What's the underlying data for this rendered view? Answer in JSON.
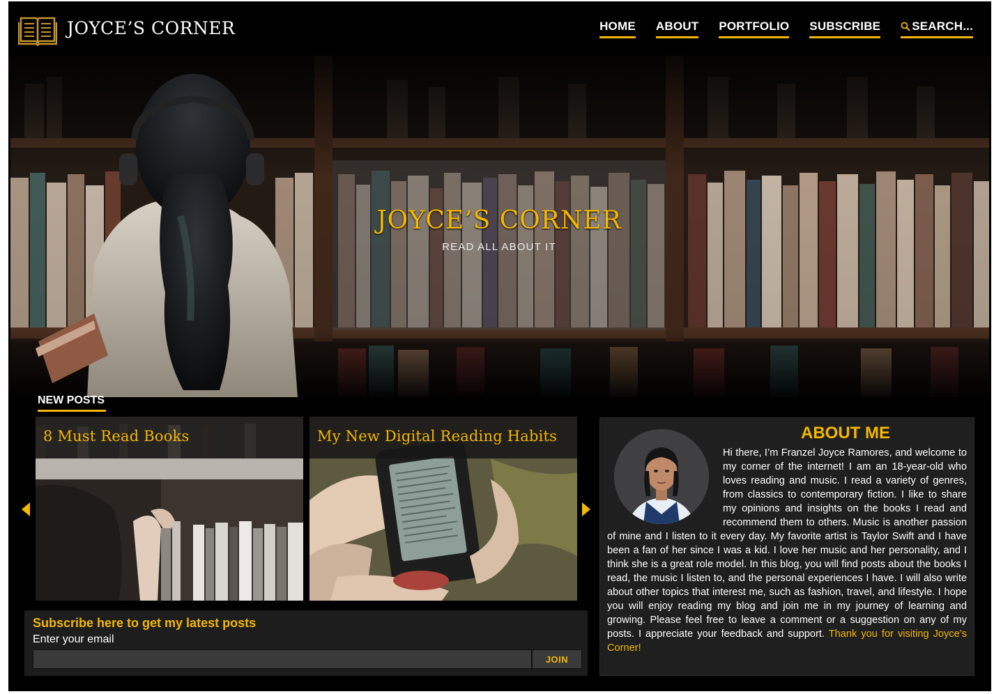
{
  "header": {
    "brand": "JOYCE’S CORNER",
    "logo_icon": "open-book-icon",
    "nav": [
      {
        "label": "HOME"
      },
      {
        "label": "ABOUT"
      },
      {
        "label": "PORTFOLIO"
      },
      {
        "label": "SUBSCRIBE"
      }
    ],
    "search_label": "SEARCH...",
    "search_icon": "search-icon"
  },
  "hero": {
    "title": "JOYCE’S CORNER",
    "tagline": "READ ALL ABOUT IT"
  },
  "new_posts": {
    "label": "NEW POSTS",
    "posts": [
      {
        "title": "8 Must Read Books"
      },
      {
        "title": "My New Digital Reading Habits"
      }
    ],
    "prev_icon": "caret-left-icon",
    "next_icon": "caret-right-icon"
  },
  "subscribe": {
    "heading": "Subscribe here to get my latest posts",
    "label": "Enter your email",
    "input_value": "",
    "button": "JOIN"
  },
  "about": {
    "title": "ABOUT ME",
    "body": "Hi there, I’m Franzel Joyce Ramores, and welcome to my corner of the internet! I am an 18-year-old who loves reading and music. I read a variety of genres, from classics to contemporary fiction. I like to share my opinions and insights on the books I read and recommend them to others. Music is another passion of mine and I listen to it every day. My favorite artist is Taylor Swift and I have been a fan of her since I was a kid. I love her music and her personality, and I think she is a great role model. In this blog, you will find posts about the books I read, the music I listen to, and the personal experiences I have. I will also write about other topics that interest me, such as fashion, travel, and lifestyle. I hope you will enjoy reading my blog and join me in my journey of learning and growing. Please feel free to leave a comment or a suggestion on any of my posts. I appreciate your feedback and support.",
    "closing": "Thank you for visiting Joyce’s Corner!"
  },
  "colors": {
    "accent": "#f5b800",
    "background": "#000000",
    "panel": "#1f1f1f"
  }
}
